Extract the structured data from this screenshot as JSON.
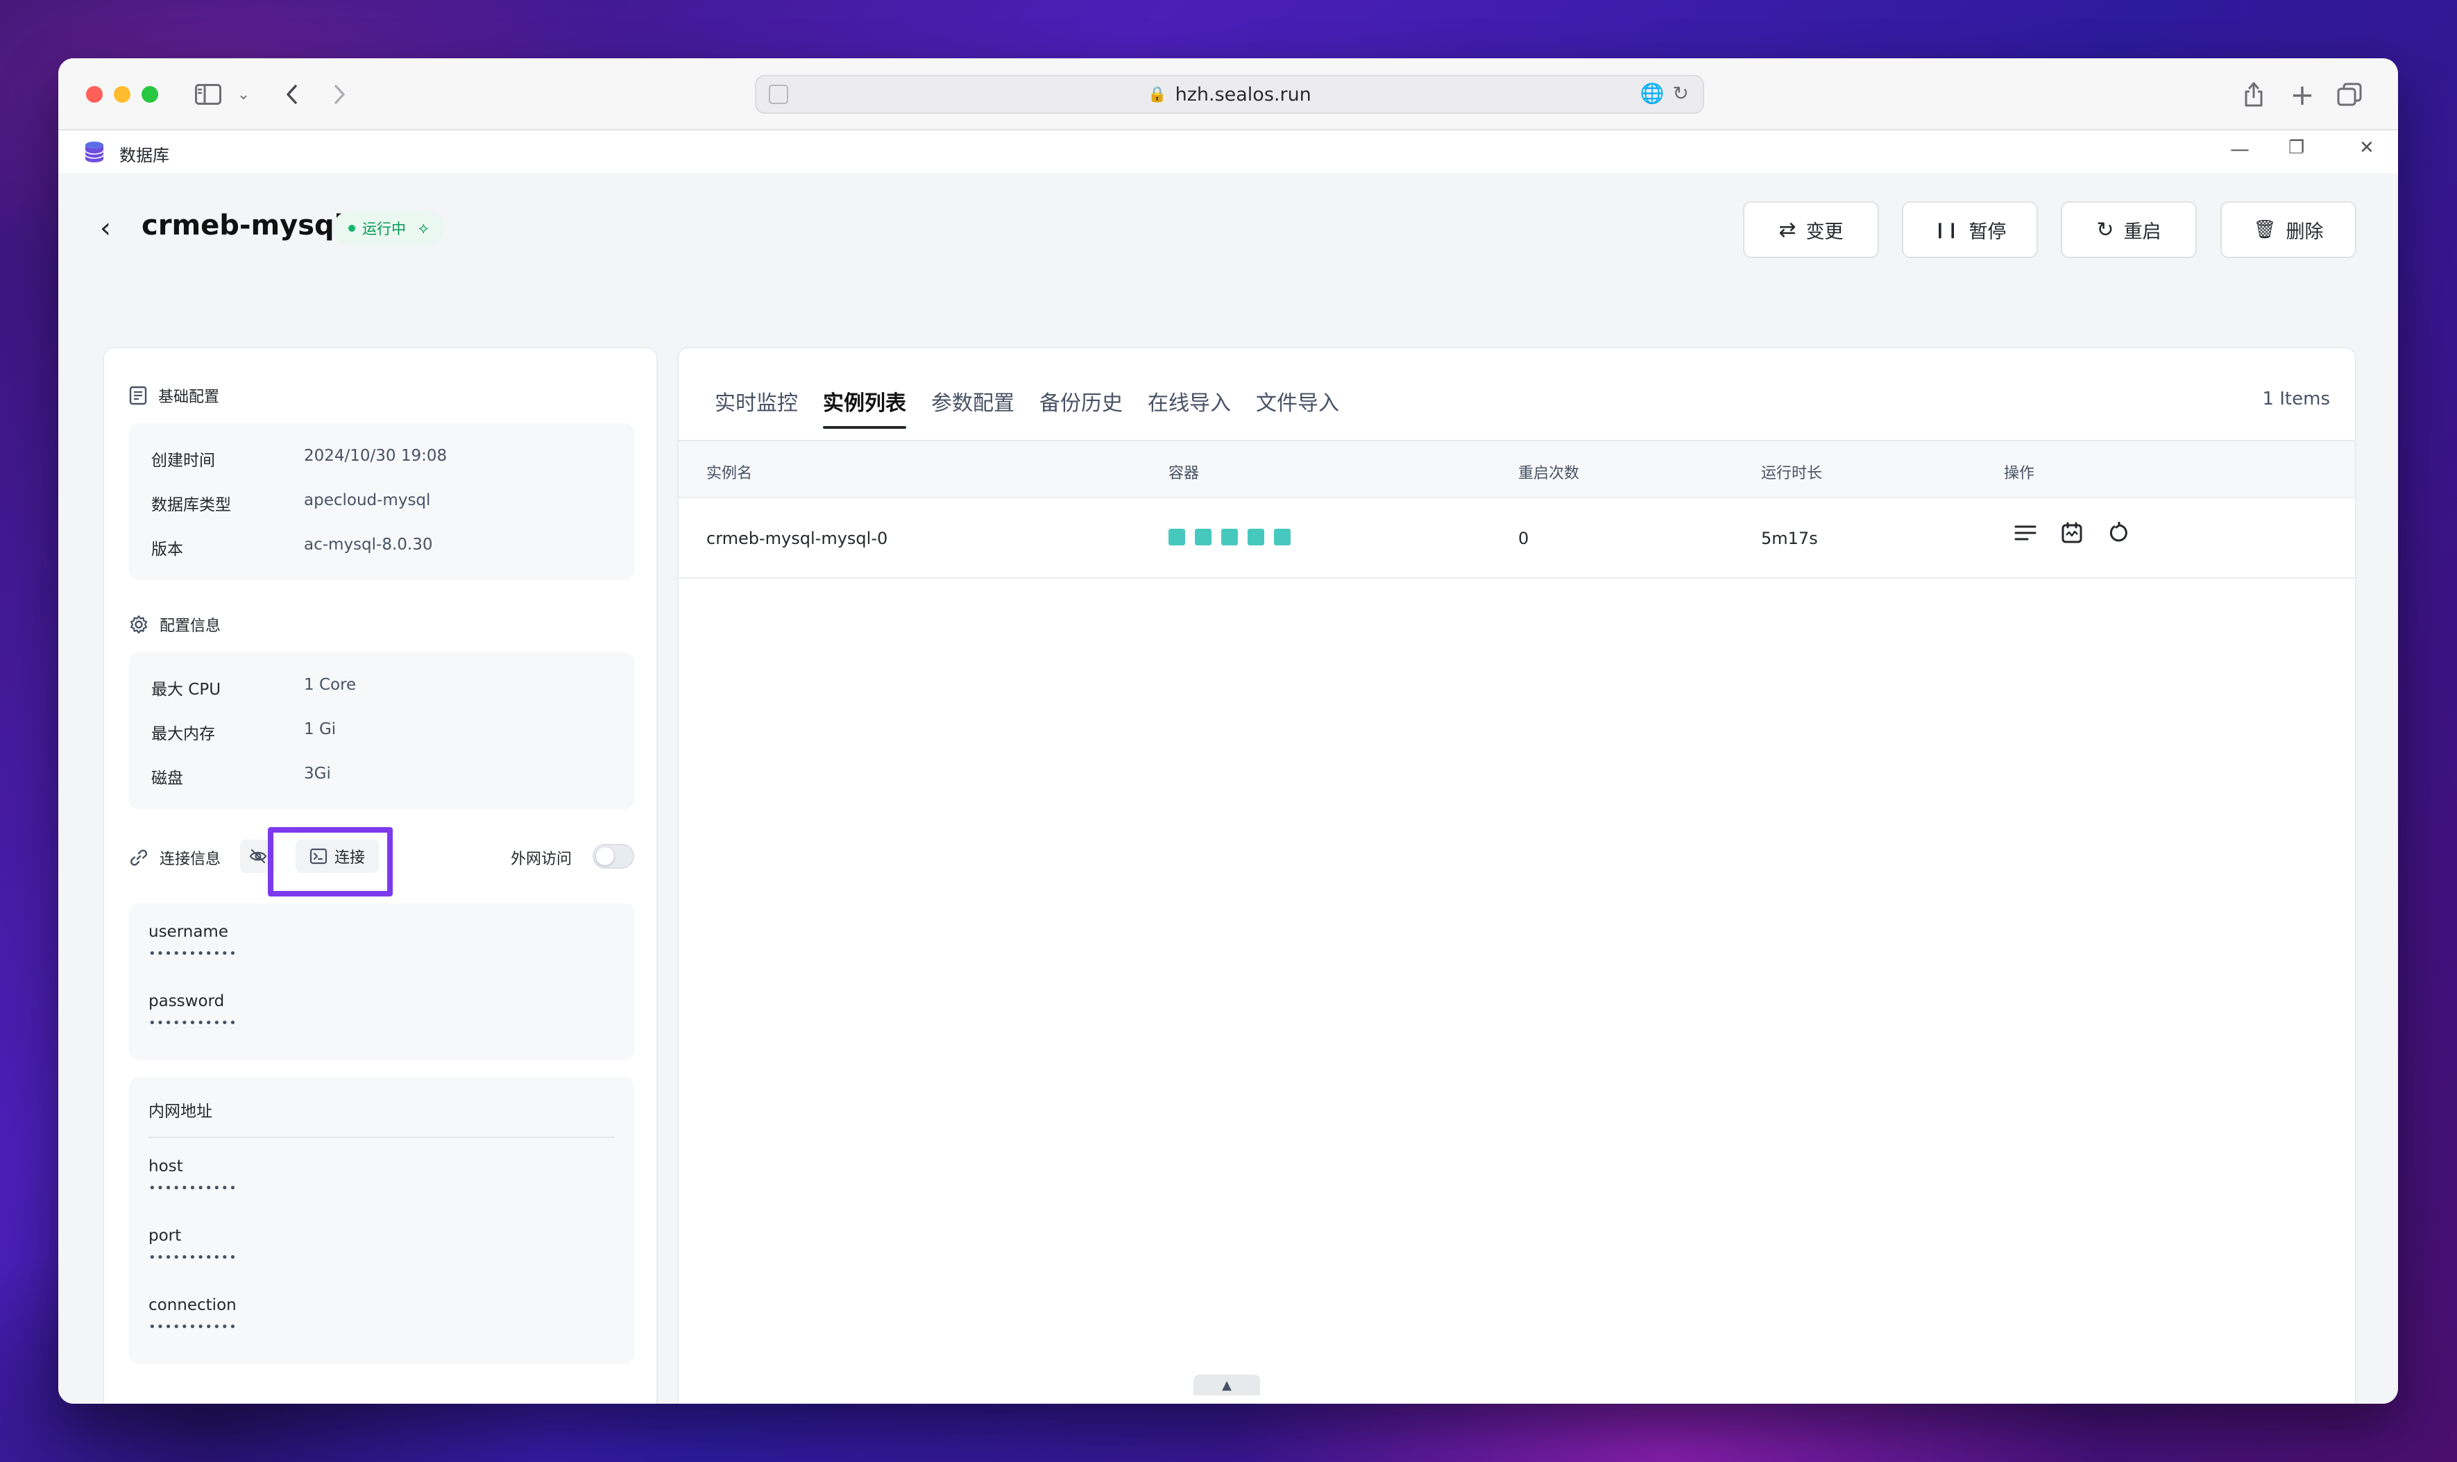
{
  "browser": {
    "url": "hzh.sealos.run",
    "lock_icon": "🔒",
    "translate_icon": "🌐",
    "reload_icon": "↻"
  },
  "app": {
    "title": "数据库",
    "minimize": "—",
    "restore": "❐",
    "close": "✕"
  },
  "header": {
    "back": "‹",
    "db_name": "crmeb-mysql",
    "status": "运行中",
    "status_icon": "⟡",
    "buttons": {
      "change": "变更",
      "pause": "暂停",
      "restart": "重启",
      "delete": "删除"
    },
    "icons": {
      "change": "⇄",
      "pause": "❙❙",
      "restart": "↻",
      "delete": "🗑"
    }
  },
  "basic": {
    "title": "基础配置",
    "rows": [
      {
        "k": "创建时间",
        "v": "2024/10/30 19:08"
      },
      {
        "k": "数据库类型",
        "v": "apecloud-mysql"
      },
      {
        "k": "版本",
        "v": "ac-mysql-8.0.30"
      }
    ]
  },
  "config": {
    "title": "配置信息",
    "rows": [
      {
        "k": "最大 CPU",
        "v": "1 Core"
      },
      {
        "k": "最大内存",
        "v": "1 Gi"
      },
      {
        "k": "磁盘",
        "v": "3Gi"
      }
    ]
  },
  "connection": {
    "title": "连接信息",
    "connect_button": "连接",
    "external_access": "外网访问",
    "mask": "•••••••••••",
    "credentials": [
      {
        "label": "username"
      },
      {
        "label": "password"
      }
    ],
    "internal_title": "内网地址",
    "internal": [
      {
        "label": "host"
      },
      {
        "label": "port"
      },
      {
        "label": "connection"
      }
    ]
  },
  "tabs": [
    "实时监控",
    "实例列表",
    "参数配置",
    "备份历史",
    "在线导入",
    "文件导入"
  ],
  "active_tab": 1,
  "items_count": "1 Items",
  "table": {
    "headers": [
      "实例名",
      "容器",
      "重启次数",
      "运行时长",
      "操作"
    ],
    "rows": [
      {
        "name": "crmeb-mysql-mysql-0",
        "containers": 5,
        "restarts": "0",
        "uptime": "5m17s"
      }
    ]
  },
  "colors": {
    "accent_highlight": "#7c3aed",
    "status_green": "#039855",
    "container_teal": "#47c8bf"
  }
}
